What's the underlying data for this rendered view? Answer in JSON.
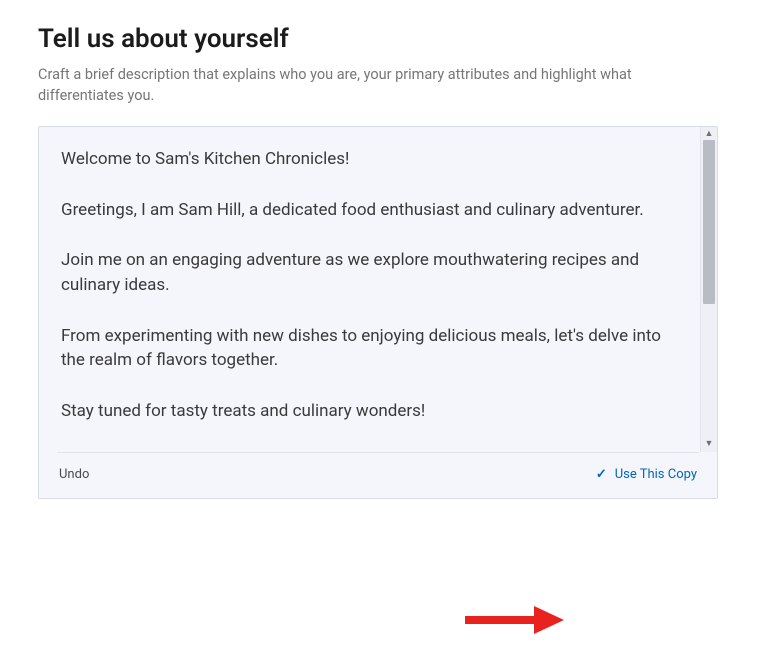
{
  "page": {
    "title": "Tell us about yourself",
    "subtitle": "Craft a brief description that explains who you are, your primary attributes and highlight what differentiates you."
  },
  "editor": {
    "paragraphs": [
      "Welcome to Sam's Kitchen Chronicles!",
      "Greetings, I am Sam Hill, a dedicated food enthusiast and culinary adventurer.",
      "Join me on an engaging adventure as we explore mouthwatering recipes and culinary ideas.",
      "From experimenting with new dishes to enjoying delicious meals, let's delve into the realm of flavors together.",
      "Stay tuned for tasty treats and culinary wonders!"
    ]
  },
  "footer": {
    "undo_label": "Undo",
    "use_copy_label": "Use This Copy"
  },
  "icons": {
    "scroll_up": "▲",
    "scroll_down": "▼",
    "check": "✓"
  },
  "colors": {
    "link": "#0067b8",
    "card_bg": "#f4f6fb",
    "arrow": "#e8221f"
  }
}
